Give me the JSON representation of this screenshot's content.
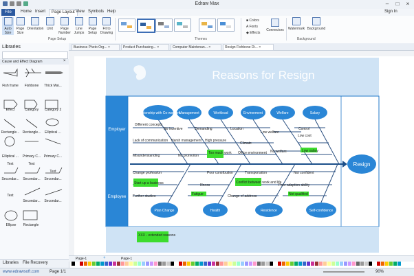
{
  "window": {
    "title": "Edraw Max",
    "sign_in": "Sign In"
  },
  "menu": {
    "file": "File",
    "items": [
      "Home",
      "Insert",
      "Page Layout",
      "View",
      "Symbols",
      "Help"
    ]
  },
  "ribbon": {
    "buttons": [
      "Auto Size",
      "Page Size",
      "Orientation",
      "Unit",
      "Page Number",
      "Line Jumps",
      "Page Setup",
      "Fit to Drawing"
    ],
    "group_page_setup": "Page Setup",
    "group_themes": "Themes",
    "group_background": "Background",
    "colors": "Colors",
    "fonts": "Fonts",
    "effects": "Effects",
    "connectors": "Connectors",
    "watermark": "Watermark",
    "background": "Background"
  },
  "library": {
    "title": "Libraries",
    "category": "Cause and Effect Diagram",
    "shapes": [
      "Fish frame",
      "Fishbone",
      "Thick Mai...",
      "Effect",
      "Category",
      "Category 2",
      "Rectangle...",
      "Rectangle...",
      "Elliptical ...",
      "Elliptical ...",
      "Primary C...",
      "Primary C...",
      "Text",
      "Text",
      "Text",
      "Secondar...",
      "Secondar...",
      "Secondar...",
      "Text",
      "Secondar...",
      "Secondar...",
      "Ellipse",
      "Rectangle"
    ],
    "tabs": [
      "Libraries",
      "File Recovery"
    ]
  },
  "doc_tabs": [
    "Business Photo Org...",
    "Product Purchasing...",
    "Computer Maintenan...",
    "Resign Fishbone Di..."
  ],
  "diagram": {
    "title": "Reasons for Resign",
    "effect": "Resign",
    "side_labels": [
      "Employer",
      "Employee"
    ],
    "top_categories": [
      "Relationship with Co-workers",
      "Management",
      "Workload",
      "Environment",
      "Welfare",
      "Salary"
    ],
    "bottom_categories": [
      "Plan Change",
      "Health",
      "Residence",
      "Self-confidence"
    ],
    "causes_top": [
      "Different concepts",
      "No incentive",
      "Demanding",
      "Location",
      "Low welfare",
      "Control",
      "Lack of communication",
      "Harsh management",
      "High pressure",
      "Climate",
      "Low cost",
      "Misunderstanding",
      "No promotion",
      "Too much work",
      "Office environment",
      "No welfare",
      "Low salary"
    ],
    "causes_bottom": [
      "Change profession",
      "Poor contribution",
      "Transportation",
      "Not confident",
      "Start up a business",
      "Illness",
      "Conflict between work and life",
      "Poor adaption ability",
      "Further studies",
      "Fatigue",
      "Change of address",
      "Not qualified"
    ],
    "note": "XXX - extended reasons"
  },
  "status": {
    "page_tab": "Page-1",
    "page_tab_active": "Page-1",
    "url": "www.edrawsoft.com",
    "page_info": "Page 1/1",
    "zoom": "90%"
  }
}
